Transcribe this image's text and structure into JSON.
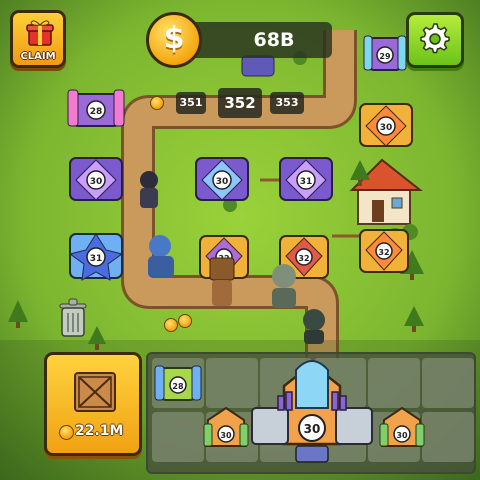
{
  "hud": {
    "claim_label": "CLAIM",
    "coin_symbol": "$",
    "coin_total": "68B"
  },
  "damage_numbers": {
    "left": "351",
    "center": "352",
    "right": "353"
  },
  "board_towers": [
    {
      "level": "28"
    },
    {
      "level": "30"
    },
    {
      "level": "30"
    },
    {
      "level": "31"
    },
    {
      "level": "30"
    },
    {
      "level": "31"
    },
    {
      "level": "32"
    },
    {
      "level": "32"
    },
    {
      "level": "32"
    },
    {
      "level": "29"
    }
  ],
  "shop": {
    "price": "22.1M"
  },
  "inventory": {
    "towers": [
      {
        "level": "28"
      },
      {
        "level": "30"
      },
      {
        "level": "30"
      },
      {
        "level": "30"
      }
    ]
  },
  "colors": {
    "grass": "#6fa82b",
    "path": "#c89a5a",
    "gold": "#f5a60f",
    "settings_green": "#6cc21a"
  },
  "icons": {
    "gift": "gift-icon",
    "coin": "coin-icon",
    "settings": "gear-icon",
    "trash": "trash-icon",
    "crate": "crate-icon"
  }
}
